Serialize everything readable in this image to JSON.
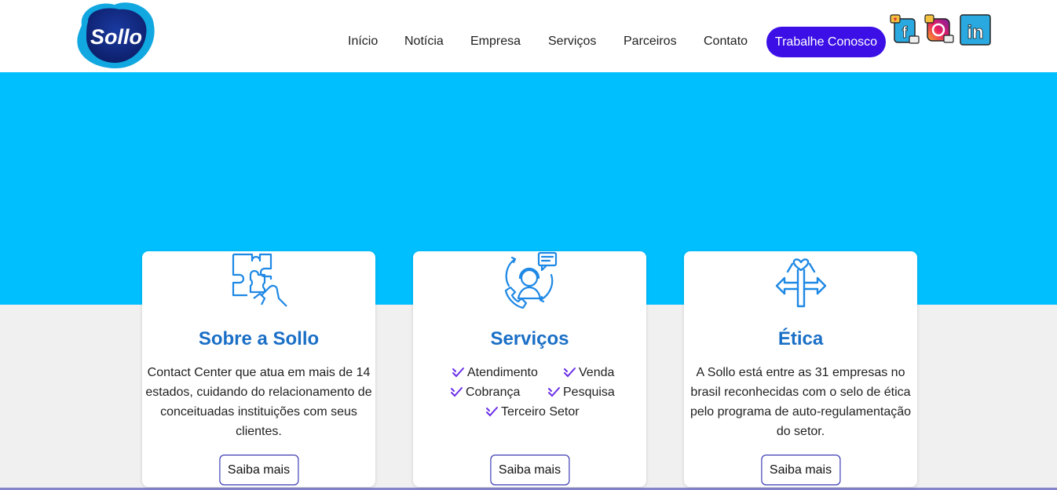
{
  "brand": {
    "logo_text": "Sollo"
  },
  "nav": {
    "items": [
      "Início",
      "Notícia",
      "Empresa",
      "Serviços",
      "Parceiros",
      "Contato"
    ],
    "cta_label": "Trabalhe Conosco",
    "social": [
      "facebook-icon",
      "instagram-icon",
      "linkedin-icon"
    ]
  },
  "colors": {
    "hero": "#00bfff",
    "cta": "#3b0fe6",
    "title": "#1a6fc6",
    "icon": "#1e88e5",
    "check": "#6a2ee8"
  },
  "cards": [
    {
      "icon": "puzzle-hand-icon",
      "title": "Sobre a Sollo",
      "text": "Contact Center que atua em mais de 14 estados, cuidando do relacionamento de conceituadas instituições com seus clientes.",
      "button": "Saiba mais"
    },
    {
      "icon": "call-center-agent-icon",
      "title": "Serviços",
      "services": [
        "Atendimento",
        "Venda",
        "Cobrança",
        "Pesquisa",
        "Terceiro Setor"
      ],
      "button": "Saiba mais"
    },
    {
      "icon": "crossroads-heart-icon",
      "title": "Ética",
      "text": "A Sollo está entre as 31 empresas no brasil reconhecidas com o selo de ética pelo programa de auto-regulamentação do setor.",
      "button": "Saiba mais"
    }
  ]
}
